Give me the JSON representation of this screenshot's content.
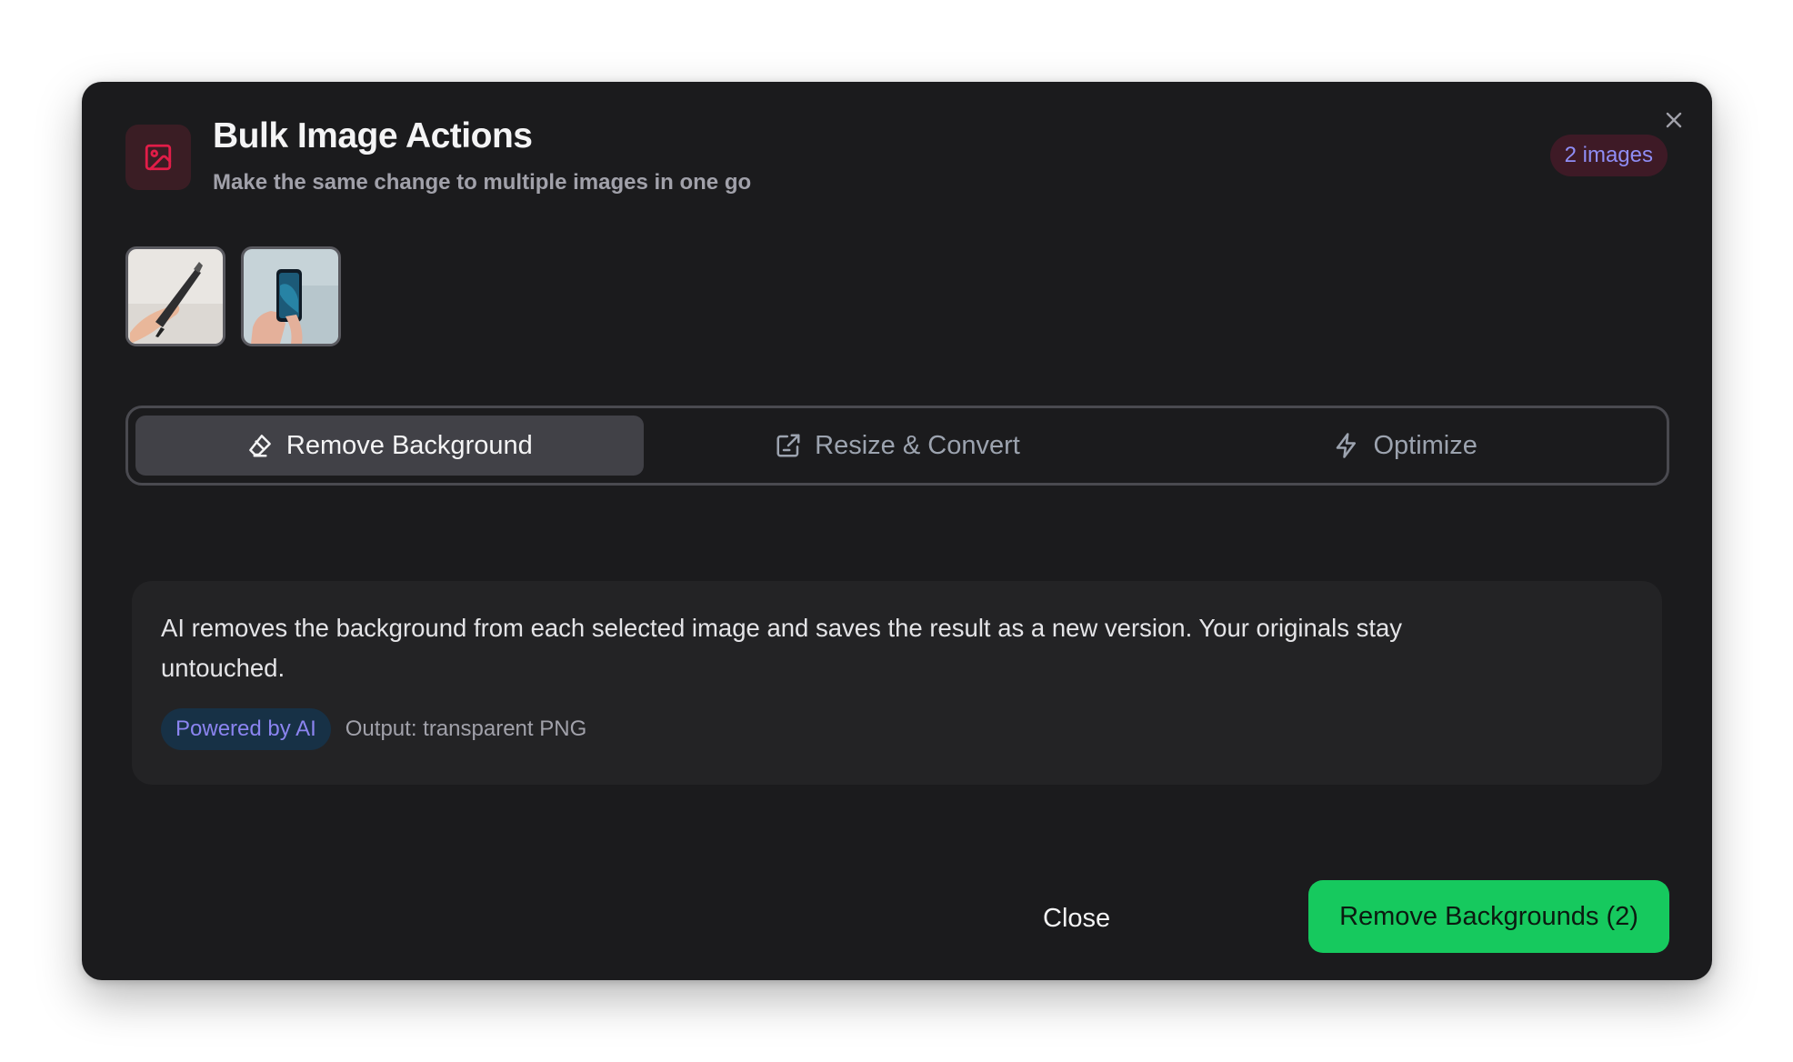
{
  "dialog": {
    "title": "Bulk Image Actions",
    "subtitle": "Make the same change to multiple images in one go",
    "image_count_badge": "2 images",
    "header_icon": "image-icon",
    "close_icon": "close-icon"
  },
  "thumbnails": [
    {
      "alt": "Hand holding black stylus pen"
    },
    {
      "alt": "Hand holding smartphone"
    }
  ],
  "tabs": [
    {
      "label": "Remove Background",
      "icon": "eraser-icon",
      "active": true
    },
    {
      "label": "Resize & Convert",
      "icon": "external-edit-icon",
      "active": false
    },
    {
      "label": "Optimize",
      "icon": "lightning-icon",
      "active": false
    }
  ],
  "info": {
    "description": "AI removes the background from each selected image and saves the result as a new version. Your originals stay untouched.",
    "badge": "Powered by AI",
    "output": "Output: transparent PNG"
  },
  "footer": {
    "close_label": "Close",
    "primary_label": "Remove Backgrounds (2)"
  },
  "colors": {
    "modal_bg": "#1b1b1d",
    "accent_green": "#16c95e",
    "icon_red": "#e11d48",
    "badge_purple": "#8f8df5"
  }
}
